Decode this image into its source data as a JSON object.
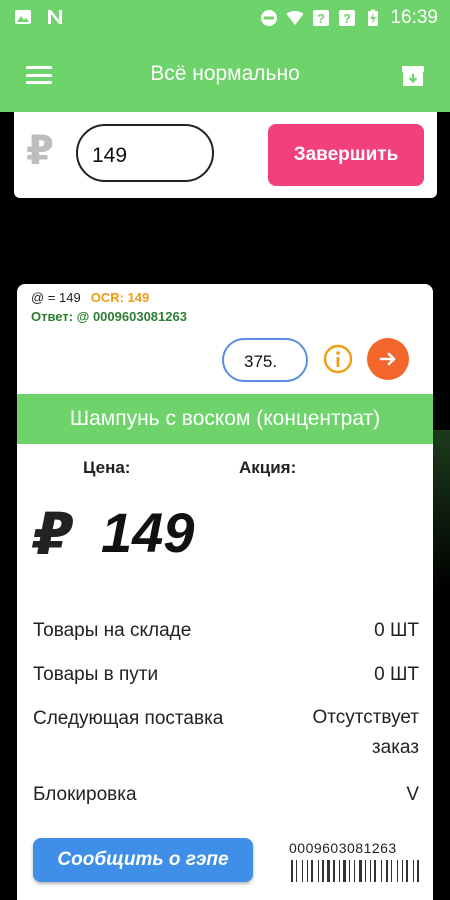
{
  "status_bar": {
    "time": "16:39"
  },
  "app_bar": {
    "title": "Всё нормально"
  },
  "entry": {
    "currency_symbol": "₽",
    "price_value": "149",
    "finish_label": "Завершить"
  },
  "scan": {
    "line1_prefix": "@ = 149",
    "ocr_label": "OCR: 149",
    "answer": "Ответ: @ 0009603081263",
    "quantity_value": "375."
  },
  "product": {
    "name": "Шампунь с воском (концентрат)",
    "price_label": "Цена:",
    "promo_label": "Акция:",
    "currency_symbol": "₽",
    "price": "149",
    "details": [
      {
        "label": "Товары на складе",
        "value": "0 ШТ"
      },
      {
        "label": "Товары в пути",
        "value": "0 ШТ"
      },
      {
        "label": "Следующая поставка",
        "value": "Отсутствует заказ"
      },
      {
        "label": "Блокировка",
        "value": "V"
      }
    ],
    "report_label": "Сообщить о гэпе",
    "barcode_number": "0009603081263"
  },
  "colors": {
    "primary": "#6fd36b",
    "finish": "#f3407a",
    "report": "#3f8ee8",
    "next": "#f2662b",
    "ocr": "#f39c12"
  }
}
